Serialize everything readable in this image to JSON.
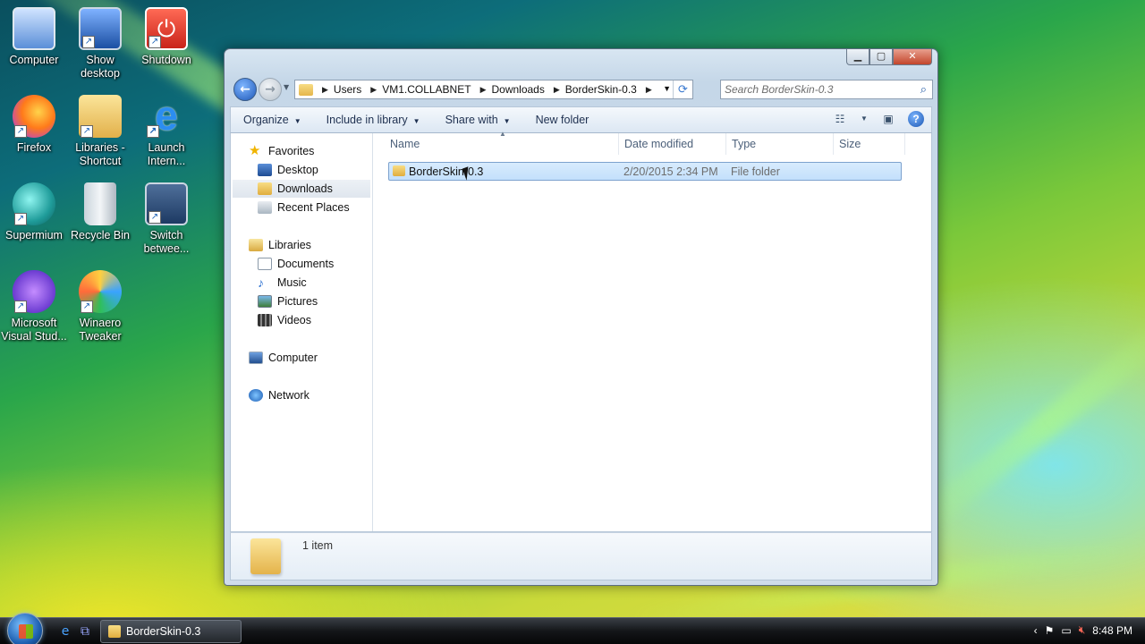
{
  "desktop": {
    "icons": [
      {
        "label": "Computer"
      },
      {
        "label": "Show desktop"
      },
      {
        "label": "Shutdown"
      },
      {
        "label": "Firefox"
      },
      {
        "label": "Libraries - Shortcut"
      },
      {
        "label": "Launch Intern..."
      },
      {
        "label": "Supermium"
      },
      {
        "label": "Recycle Bin"
      },
      {
        "label": "Switch betwee..."
      },
      {
        "label": "Microsoft Visual Stud..."
      },
      {
        "label": "Winaero Tweaker"
      }
    ]
  },
  "window": {
    "breadcrumb": [
      "Users",
      "VM1.COLLABNET",
      "Downloads",
      "BorderSkin-0.3"
    ],
    "search_placeholder": "Search BorderSkin-0.3",
    "toolbar": {
      "organize": "Organize",
      "include": "Include in library",
      "share": "Share with",
      "new_folder": "New folder"
    },
    "nav": {
      "favorites": "Favorites",
      "desktop": "Desktop",
      "downloads": "Downloads",
      "recent": "Recent Places",
      "libraries": "Libraries",
      "documents": "Documents",
      "music": "Music",
      "pictures": "Pictures",
      "videos": "Videos",
      "computer": "Computer",
      "network": "Network"
    },
    "columns": {
      "name": "Name",
      "date": "Date modified",
      "type": "Type",
      "size": "Size"
    },
    "files": [
      {
        "name": "BorderSkin-0.3",
        "date": "2/20/2015 2:34 PM",
        "type": "File folder",
        "size": ""
      }
    ],
    "details": {
      "count": "1 item"
    }
  },
  "taskbar": {
    "task_label": "BorderSkin-0.3",
    "clock": "8:48 PM"
  },
  "colors": {
    "accent": "#1e58b8",
    "selection": "#c3e0fc"
  }
}
